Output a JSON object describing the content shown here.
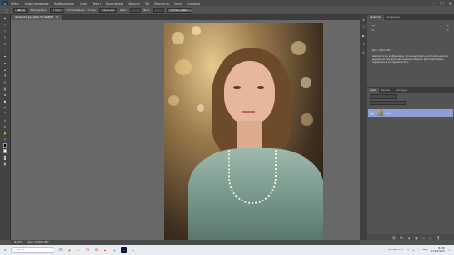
{
  "app": {
    "logo": "Ps",
    "menu": [
      "Файл",
      "Редактирование",
      "Изображение",
      "Слои",
      "Текст",
      "Выделение",
      "Фильтр",
      "3D",
      "Просмотр",
      "Окно",
      "Справка"
    ]
  },
  "options": {
    "feather_label": "Растушевка:",
    "feather_value": "0 пикс",
    "smooth_label": "Сглаживание",
    "style_label": "Стиль:",
    "style_value": "Обычный",
    "width_label": "Шир.:",
    "height_label": "Выс.:",
    "refine_button": "Уточн. край..."
  },
  "document": {
    "tab_title": "a6a4e2fe3.jpg @ 66,7% (RGB/8)",
    "zoom": "66,67%",
    "doc_size": "Док: 1,59M/1,59M"
  },
  "panels": {
    "top_tabs": [
      "Свойства",
      "Коррекция"
    ],
    "width_label": "Ш:",
    "height_label": "В:",
    "x_label": "X:",
    "y_label": "Y:",
    "doc_info": "Док: 1000×1500",
    "info_text": "Щелкните по изображению, чтобы выполнить нестройку цвета и выделения пикселов на основании образца. Дополнительные параметры в инструменте Ctrl...",
    "layer_tabs": [
      "Слои",
      "Каналы",
      "Контуры"
    ],
    "layer_name": "Фон"
  },
  "taskbar": {
    "search_placeholder": "Поиск",
    "weather": "-2°C Облачно",
    "time": "14:39",
    "date": "11.02.2023"
  }
}
